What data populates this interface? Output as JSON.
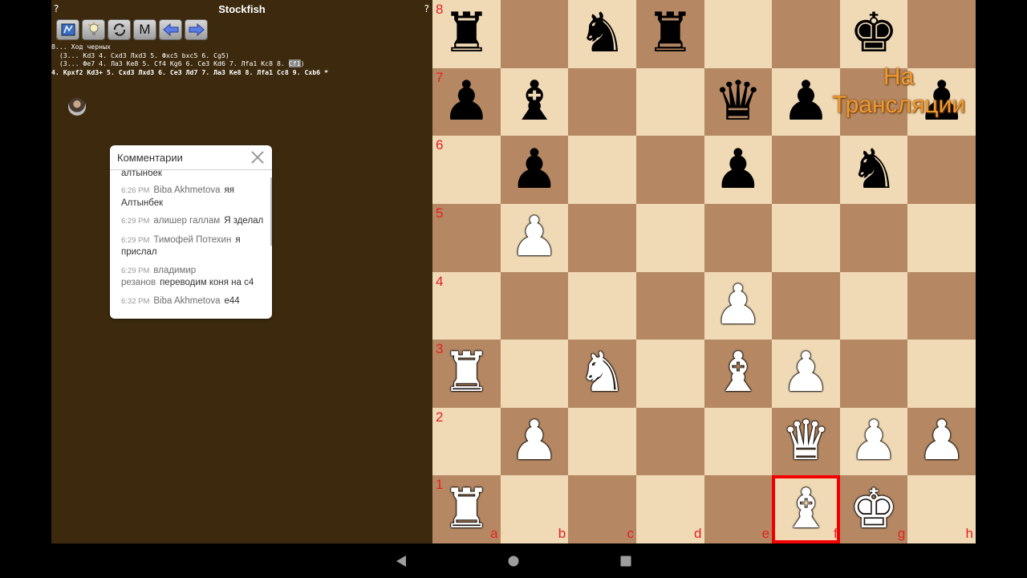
{
  "app": {
    "title": "Stockfish",
    "help_left": "?",
    "help_right": "?"
  },
  "toolbar": {
    "menu_label": "M"
  },
  "engine": {
    "line1": "8... Ход черных",
    "line2": "  (3... Kd3 4. Cxd3 Лxd3 5. Фxc5 bxc5 6. Cg5)",
    "line3_before": "  (3... Фe7 4. Ла3 Ke8 5. Cf4 Kg6 6. Ce3 Kd6 7. Лfa1 Kc8 8. ",
    "line3_highlight": "Cf1",
    "line3_after": ")",
    "line4": "4. Kpxf2 Kd3+ 5. Cxd3 Лxd3 6. Ce3 Лd7 7. Ла3 Ke8 8. Лfa1 Cc8 9. Cxb6 *"
  },
  "comments": {
    "title": "Комментарии",
    "top_partial": "алтынбек",
    "messages": [
      {
        "time": "6:26 PM",
        "name": "Biba Akhmetova",
        "text": "яя Алтынбек"
      },
      {
        "time": "6:29 PM",
        "name": "алишер галлам",
        "text": "Я зделал"
      },
      {
        "time": "6:29 PM",
        "name": "Тимофей Потехин",
        "text": "я прислал"
      },
      {
        "time": "6:29 PM",
        "name": "владимир резанов",
        "text": "переводим коня на c4"
      },
      {
        "time": "6:32 PM",
        "name": "Biba Akhmetova",
        "text": "e44"
      }
    ]
  },
  "board": {
    "rows": [
      "r.nr..k.",
      "pb..qp.p",
      ".p..p.n.",
      ".P......",
      "....P...",
      "R.N.BP..",
      ".P...QPP",
      "R....BK."
    ],
    "rank_labels": [
      "8",
      "7",
      "6",
      "5",
      "4",
      "3",
      "2",
      "1"
    ],
    "file_labels": [
      "a",
      "b",
      "c",
      "d",
      "e",
      "f",
      "g",
      "h"
    ],
    "selected_square": "f1",
    "colors": {
      "light": "#f0d9b5",
      "dark": "#b58863",
      "labels": "#e32222",
      "highlight": "#f20000"
    }
  },
  "watermark": {
    "line1": "На",
    "line2": "Трансляции"
  }
}
